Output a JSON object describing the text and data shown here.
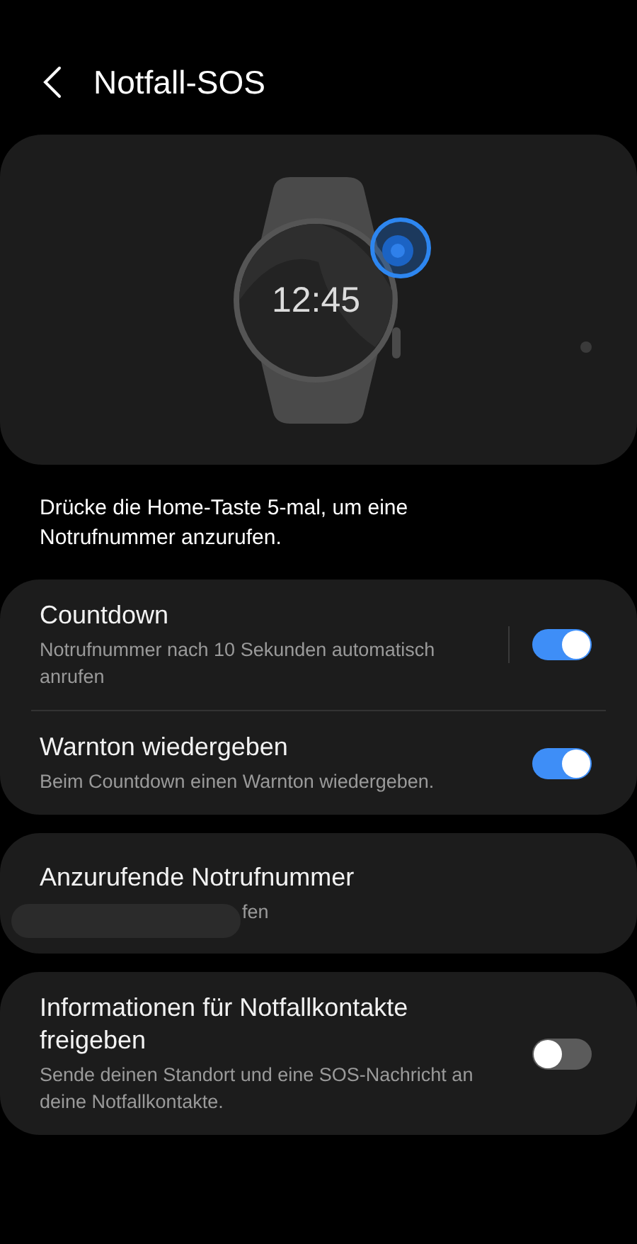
{
  "header": {
    "title": "Notfall-SOS"
  },
  "illustration": {
    "watch_time": "12:45"
  },
  "description": "Drücke die Home-Taste 5-mal, um eine Notrufnummer anzurufen.",
  "groups": [
    {
      "items": [
        {
          "kind": "switch",
          "title": "Countdown",
          "subtitle": "Notrufnummer nach 10 Sekunden automatisch anrufen",
          "on": true
        },
        {
          "kind": "switch",
          "title": "Warnton wiedergeben",
          "subtitle": "Beim Countdown einen Warnton wiedergeben.",
          "on": true
        }
      ]
    },
    {
      "items": [
        {
          "kind": "redacted",
          "title": "Anzurufende Notrufnummer",
          "subtitle": "fen"
        }
      ]
    },
    {
      "items": [
        {
          "kind": "switch",
          "title": "Informationen für Notfallkontakte freigeben",
          "subtitle": "Sende deinen Standort und eine SOS-Nachricht an deine Notfallkontakte.",
          "on": false
        }
      ]
    }
  ]
}
